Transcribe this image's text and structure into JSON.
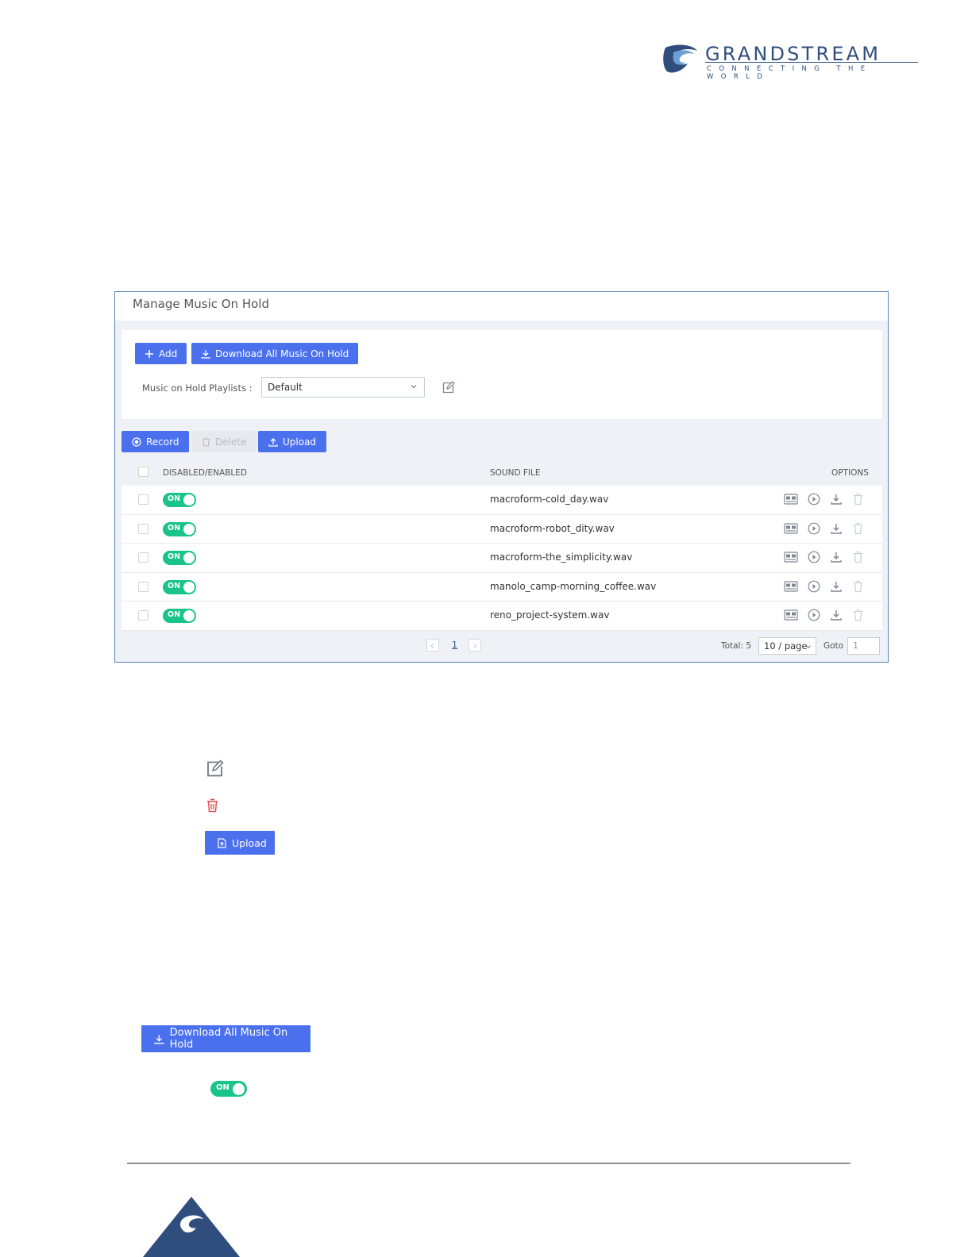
{
  "brand": {
    "name": "GRANDSTREAM",
    "tagline": "CONNECTING THE WORLD"
  },
  "panel": {
    "title": "Manage Music On Hold",
    "buttons": {
      "add": "Add",
      "download_all": "Download All Music On Hold",
      "record": "Record",
      "delete": "Delete",
      "upload": "Upload"
    },
    "playlist_label": "Music on Hold Playlists :",
    "playlist_value": "Default",
    "table": {
      "headers": {
        "enabled": "DISABLED/ENABLED",
        "sound_file": "SOUND FILE",
        "options": "OPTIONS"
      },
      "rows": [
        {
          "toggle": "ON",
          "file": "macroform-cold_day.wav"
        },
        {
          "toggle": "ON",
          "file": "macroform-robot_dity.wav"
        },
        {
          "toggle": "ON",
          "file": "macroform-the_simplicity.wav"
        },
        {
          "toggle": "ON",
          "file": "manolo_camp-morning_coffee.wav"
        },
        {
          "toggle": "ON",
          "file": "reno_project-system.wav"
        }
      ]
    },
    "pagination": {
      "current_page": "1",
      "total": "Total: 5",
      "per_page": "10 / page",
      "goto_label": "Goto",
      "goto_value": "1"
    }
  },
  "legend": {
    "upload_label": "Upload",
    "download_all_label": "Download All Music On Hold",
    "toggle_label": "ON"
  },
  "colors": {
    "primary": "#4b70ee",
    "toggle_on": "#18c48a",
    "brand": "#2f4e7d",
    "danger": "#e5484d"
  }
}
